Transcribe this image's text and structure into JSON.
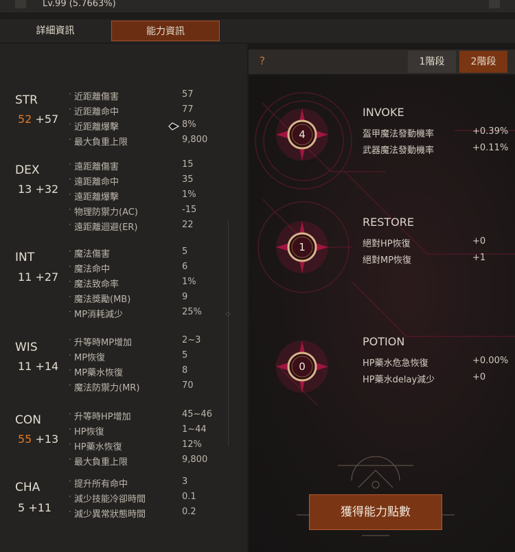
{
  "header": {
    "level_text": "Lv.99 (5.7663%)"
  },
  "tabs": [
    {
      "label": "詳細資訊"
    },
    {
      "label": "能力資訊"
    }
  ],
  "stats": [
    {
      "name": "STR",
      "base": "52",
      "bonus": "+57",
      "highlight": true,
      "rows": [
        {
          "label": "近距離傷害",
          "value": "57"
        },
        {
          "label": "近距離命中",
          "value": "77"
        },
        {
          "label": "近距離爆擊",
          "value": "8%"
        },
        {
          "label": "最大負重上限",
          "value": "9,800"
        }
      ]
    },
    {
      "name": "DEX",
      "base": "13",
      "bonus": "+32",
      "highlight": false,
      "rows": [
        {
          "label": "遠距離傷害",
          "value": "15"
        },
        {
          "label": "遠距離命中",
          "value": "35"
        },
        {
          "label": "遠距離爆擊",
          "value": "1%"
        },
        {
          "label": "物理防禦力(AC)",
          "value": "-15"
        },
        {
          "label": "遠距離迴避(ER)",
          "value": "22"
        }
      ]
    },
    {
      "name": "INT",
      "base": "11",
      "bonus": "+27",
      "highlight": false,
      "rows": [
        {
          "label": "魔法傷害",
          "value": "5"
        },
        {
          "label": "魔法命中",
          "value": "6"
        },
        {
          "label": "魔法致命率",
          "value": "1%"
        },
        {
          "label": "魔法獎勵(MB)",
          "value": "9"
        },
        {
          "label": "MP消耗減少",
          "value": "25%"
        }
      ]
    },
    {
      "name": "WIS",
      "base": "11",
      "bonus": "+14",
      "highlight": false,
      "rows": [
        {
          "label": "升等時MP增加",
          "value": "2~3"
        },
        {
          "label": "MP恢復",
          "value": "5"
        },
        {
          "label": "MP藥水恢復",
          "value": "8"
        },
        {
          "label": "魔法防禦力(MR)",
          "value": "70"
        }
      ]
    },
    {
      "name": "CON",
      "base": "55",
      "bonus": "+13",
      "highlight": true,
      "rows": [
        {
          "label": "升等時HP增加",
          "value": "45~46"
        },
        {
          "label": "HP恢復",
          "value": "1~44"
        },
        {
          "label": "HP藥水恢復",
          "value": "12%"
        },
        {
          "label": "最大負重上限",
          "value": "9,800"
        }
      ]
    },
    {
      "name": "CHA",
      "base": "5",
      "bonus": "+11",
      "highlight": false,
      "rows": [
        {
          "label": "提升所有命中",
          "value": "3"
        },
        {
          "label": "減少技能冷卻時間",
          "value": "0.1"
        },
        {
          "label": "減少異常狀態時間",
          "value": "0.2"
        }
      ]
    }
  ],
  "right_panel": {
    "help_label": "?",
    "segments": [
      {
        "label": "1階段"
      },
      {
        "label": "2階段"
      }
    ],
    "sections": [
      {
        "title": "INVOKE",
        "level": "4",
        "rows": [
          {
            "label": "盔甲魔法發動機率",
            "value": "+0.39%"
          },
          {
            "label": "武器魔法發動機率",
            "value": "+0.11%"
          }
        ]
      },
      {
        "title": "RESTORE",
        "level": "1",
        "rows": [
          {
            "label": "絕對HP恢復",
            "value": "+0"
          },
          {
            "label": "絕對MP恢復",
            "value": "+1"
          }
        ]
      },
      {
        "title": "POTION",
        "level": "0",
        "rows": [
          {
            "label": "HP藥水危急恢復",
            "value": "+0.00%"
          },
          {
            "label": "HP藥水delay減少",
            "value": "+0"
          }
        ]
      }
    ],
    "action_button": "獲得能力點數"
  },
  "colors": {
    "accent": "#7a3514",
    "highlight_stat": "#e07a26",
    "glow": "#c0184a"
  }
}
